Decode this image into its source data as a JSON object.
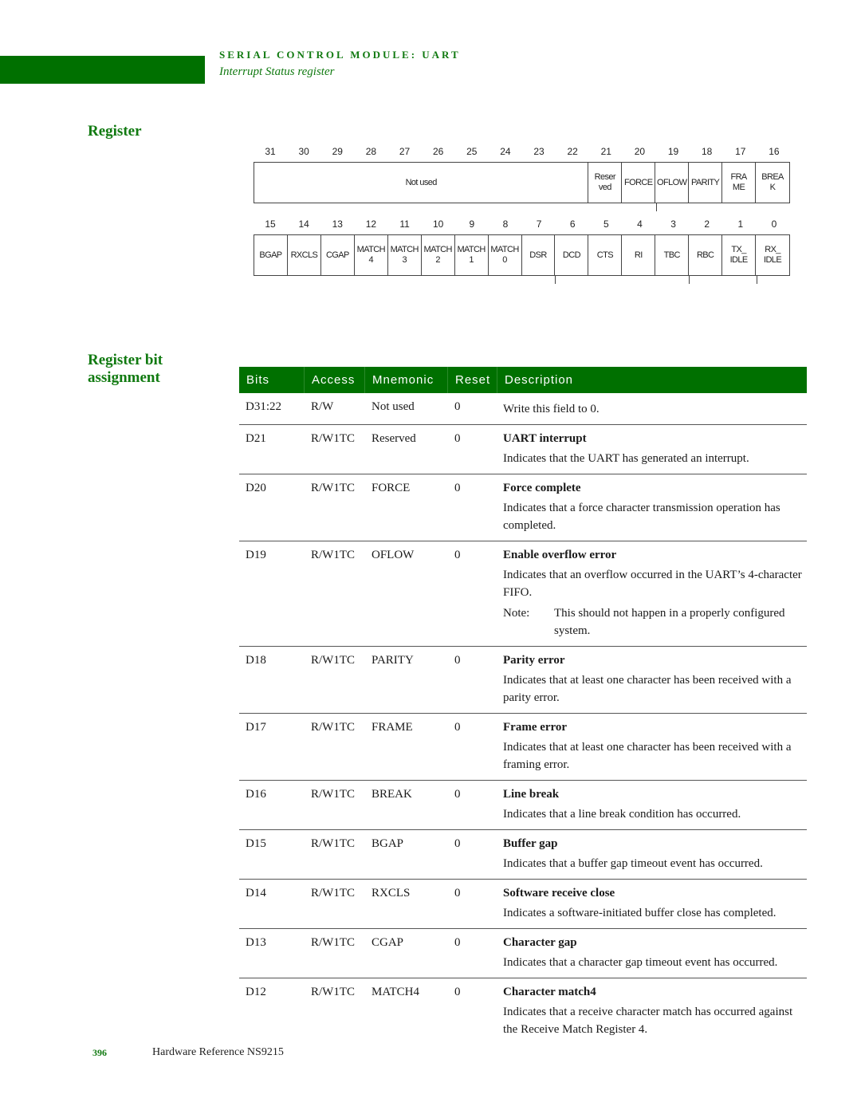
{
  "header": {
    "chapter": "SERIAL CONTROL MODULE: UART",
    "subtitle": "Interrupt Status register"
  },
  "sections": {
    "register": "Register",
    "bit_assignment": "Register bit assignment"
  },
  "register_diagram": {
    "upper_bits": [
      "31",
      "30",
      "29",
      "28",
      "27",
      "26",
      "25",
      "24",
      "23",
      "22",
      "21",
      "20",
      "19",
      "18",
      "17",
      "16"
    ],
    "upper_fields": [
      {
        "label": "Not used",
        "span": 10
      },
      {
        "label": "Reser\nved",
        "span": 1
      },
      {
        "label": "FORCE",
        "span": 1
      },
      {
        "label": "OFLOW",
        "span": 1
      },
      {
        "label": "PARITY",
        "span": 1
      },
      {
        "label": "FRA\nME",
        "span": 1
      },
      {
        "label": "BREA\nK",
        "span": 1
      }
    ],
    "lower_bits": [
      "15",
      "14",
      "13",
      "12",
      "11",
      "10",
      "9",
      "8",
      "7",
      "6",
      "5",
      "4",
      "3",
      "2",
      "1",
      "0"
    ],
    "lower_fields": [
      {
        "label": "BGAP",
        "span": 1
      },
      {
        "label": "RXCLS",
        "span": 1
      },
      {
        "label": "CGAP",
        "span": 1
      },
      {
        "label": "MATCH\n4",
        "span": 1
      },
      {
        "label": "MATCH\n3",
        "span": 1
      },
      {
        "label": "MATCH\n2",
        "span": 1
      },
      {
        "label": "MATCH\n1",
        "span": 1
      },
      {
        "label": "MATCH\n0",
        "span": 1
      },
      {
        "label": "DSR",
        "span": 1
      },
      {
        "label": "DCD",
        "span": 1
      },
      {
        "label": "CTS",
        "span": 1
      },
      {
        "label": "RI",
        "span": 1
      },
      {
        "label": "TBC",
        "span": 1
      },
      {
        "label": "RBC",
        "span": 1
      },
      {
        "label": "TX_\nIDLE",
        "span": 1
      },
      {
        "label": "RX_\nIDLE",
        "span": 1
      }
    ]
  },
  "table": {
    "columns": [
      "Bits",
      "Access",
      "Mnemonic",
      "Reset",
      "Description"
    ],
    "rows": [
      {
        "bits": "D31:22",
        "access": "R/W",
        "mnemonic": "Not used",
        "reset": "0",
        "title": "",
        "text": "Write this field to 0.",
        "note": ""
      },
      {
        "bits": "D21",
        "access": "R/W1TC",
        "mnemonic": "Reserved",
        "reset": "0",
        "title": "UART interrupt",
        "text": "Indicates that the UART has generated an interrupt.",
        "note": ""
      },
      {
        "bits": "D20",
        "access": "R/W1TC",
        "mnemonic": "FORCE",
        "reset": "0",
        "title": "Force complete",
        "text": "Indicates that a force character transmission operation has completed.",
        "note": ""
      },
      {
        "bits": "D19",
        "access": "R/W1TC",
        "mnemonic": "OFLOW",
        "reset": "0",
        "title": "Enable overflow error",
        "text": "Indicates that an overflow occurred in the UART’s 4-character FIFO.",
        "note_label": "Note:",
        "note": "This should not happen in a properly configured system."
      },
      {
        "bits": "D18",
        "access": "R/W1TC",
        "mnemonic": "PARITY",
        "reset": "0",
        "title": "Parity error",
        "text": "Indicates that at least one character has been received with a parity error.",
        "note": ""
      },
      {
        "bits": "D17",
        "access": "R/W1TC",
        "mnemonic": "FRAME",
        "reset": "0",
        "title": "Frame error",
        "text": "Indicates that at least one character has been received with a framing error.",
        "note": ""
      },
      {
        "bits": "D16",
        "access": "R/W1TC",
        "mnemonic": "BREAK",
        "reset": "0",
        "title": "Line break",
        "text": "Indicates that a line break condition has occurred.",
        "note": ""
      },
      {
        "bits": "D15",
        "access": "R/W1TC",
        "mnemonic": "BGAP",
        "reset": "0",
        "title": "Buffer gap",
        "text": "Indicates that a buffer gap timeout event has occurred.",
        "note": ""
      },
      {
        "bits": "D14",
        "access": "R/W1TC",
        "mnemonic": "RXCLS",
        "reset": "0",
        "title": "Software receive close",
        "text": "Indicates a software-initiated buffer close has completed.",
        "note": ""
      },
      {
        "bits": "D13",
        "access": "R/W1TC",
        "mnemonic": "CGAP",
        "reset": "0",
        "title": "Character gap",
        "text": "Indicates that a character gap timeout event has occurred.",
        "note": ""
      },
      {
        "bits": "D12",
        "access": "R/W1TC",
        "mnemonic": "MATCH4",
        "reset": "0",
        "title": "Character match4",
        "text": "Indicates that a receive character match has occurred against the Receive Match Register 4.",
        "note": ""
      }
    ]
  },
  "footer": {
    "page_number": "396",
    "doc_title": "Hardware Reference NS9215"
  }
}
